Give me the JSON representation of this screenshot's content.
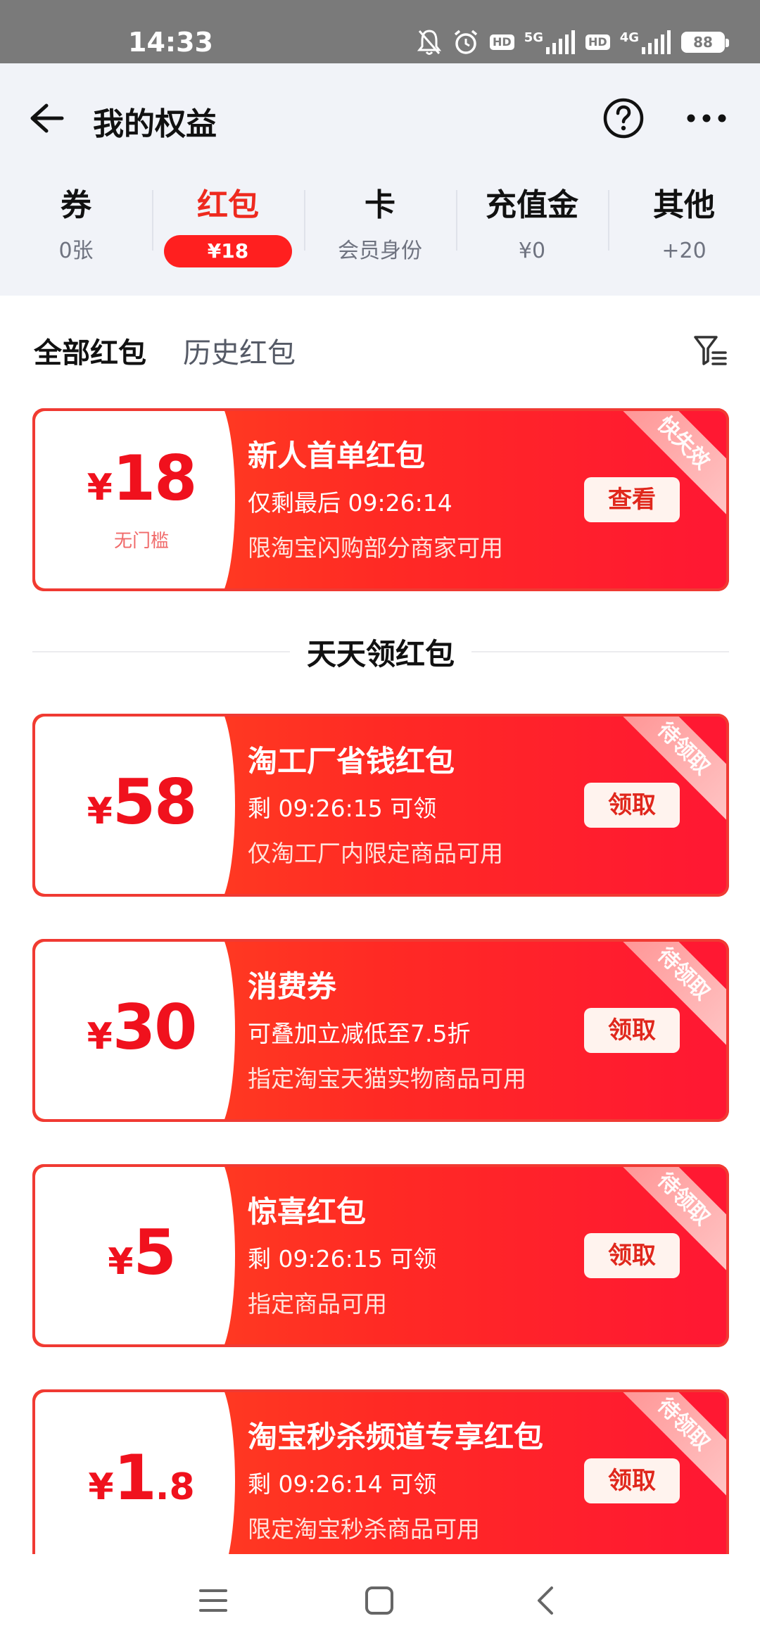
{
  "status_bar": {
    "time": "14:33",
    "network_1": "5G",
    "network_2": "4G",
    "hd_label": "HD",
    "battery": "88",
    "icons": [
      "mute-bell-icon",
      "alarm-icon",
      "signal-icon",
      "battery-icon"
    ]
  },
  "header": {
    "title": "我的权益",
    "back_icon": "arrow-left-icon",
    "help_icon": "question-circle-icon",
    "more_icon": "more-dots-icon"
  },
  "category_tabs": [
    {
      "name": "券",
      "sub": "0张",
      "active": false
    },
    {
      "name": "红包",
      "sub": "¥18",
      "active": true
    },
    {
      "name": "卡",
      "sub": "会员身份",
      "active": false
    },
    {
      "name": "充值金",
      "sub": "¥0",
      "active": false
    },
    {
      "name": "其他",
      "sub": "+20",
      "active": false
    }
  ],
  "sub_tabs": {
    "all": "全部红包",
    "history": "历史红包",
    "filter_icon": "filter-icon"
  },
  "section_title": "天天领红包",
  "cards": [
    {
      "yen": "¥",
      "amount": "18",
      "decimal": "",
      "threshold": "无门槛",
      "title": "新人首单红包",
      "line2": "仅剩最后 09:26:14",
      "line3": "限淘宝闪购部分商家可用",
      "button": "查看",
      "ribbon": "快失效"
    },
    {
      "yen": "¥",
      "amount": "58",
      "decimal": "",
      "title": "淘工厂省钱红包",
      "line2": "剩 09:26:15 可领",
      "line3": "仅淘工厂内限定商品可用",
      "button": "领取",
      "ribbon": "待领取"
    },
    {
      "yen": "¥",
      "amount": "30",
      "decimal": "",
      "title": "消费券",
      "line2": "可叠加立减低至7.5折",
      "line3": "指定淘宝天猫实物商品可用",
      "button": "领取",
      "ribbon": "待领取"
    },
    {
      "yen": "¥",
      "amount": "5",
      "decimal": "",
      "title": "惊喜红包",
      "line2": "剩 09:26:15 可领",
      "line3": "指定商品可用",
      "button": "领取",
      "ribbon": "待领取"
    },
    {
      "yen": "¥",
      "amount": "1",
      "decimal": ".8",
      "title": "淘宝秒杀频道专享红包",
      "line2": "剩 09:26:14 可领",
      "line3": "限定淘宝秒杀商品可用",
      "button": "领取",
      "ribbon": "待领取"
    }
  ],
  "nav_bar": {
    "icons": [
      "menu-lines-icon",
      "home-square-icon",
      "back-chevron-icon"
    ]
  },
  "colors": {
    "accent_red": "#ff1f1f",
    "card_gradient_start": "#ff4a1f",
    "card_gradient_end": "#ff1733",
    "header_bg": "#f1f3f8"
  }
}
